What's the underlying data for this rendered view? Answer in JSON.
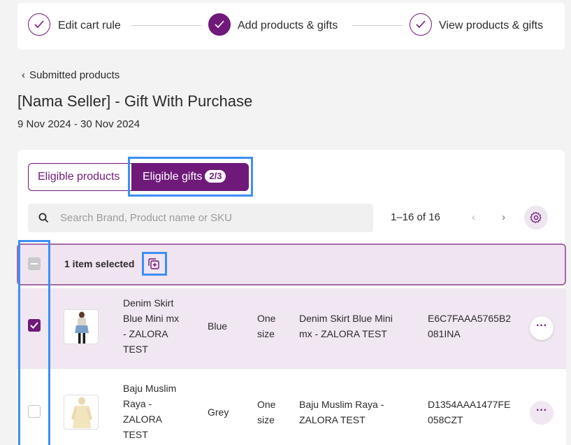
{
  "stepper": {
    "steps": [
      {
        "label": "Edit cart rule",
        "state": "done"
      },
      {
        "label": "Add products & gifts",
        "state": "active"
      },
      {
        "label": "View products & gifts",
        "state": "done"
      }
    ]
  },
  "header": {
    "back_label": "Submitted products",
    "title": "[Nama Seller] - Gift With Purchase",
    "date_range": "9 Nov 2024 - 30 Nov 2024"
  },
  "tabs": {
    "eligible_products": "Eligible products",
    "eligible_gifts": "Eligible gifts",
    "gifts_badge": "2/3"
  },
  "search": {
    "placeholder": "Search Brand, Product name or SKU",
    "value": ""
  },
  "pagination": {
    "label": "1–16 of 16"
  },
  "bulk": {
    "selected_text": "1 item selected"
  },
  "rows": [
    {
      "selected": true,
      "name_lines": [
        "Denim Skirt",
        "Blue Mini mx",
        "- ZALORA",
        "TEST"
      ],
      "color": "Blue",
      "size_lines": [
        "One",
        "size"
      ],
      "simple_name_lines": [
        "Denim Skirt Blue Mini",
        "mx - ZALORA TEST"
      ],
      "sku_lines": [
        "E6C7FAAA5765B2",
        "081INA"
      ]
    },
    {
      "selected": false,
      "name_lines": [
        "Baju Muslim",
        "Raya -",
        "ZALORA",
        "TEST"
      ],
      "color": "Grey",
      "size_lines": [
        "One",
        "size"
      ],
      "simple_name_lines": [
        "Baju Muslim Raya -",
        "ZALORA TEST"
      ],
      "sku_lines": [
        "D1354AAA1477FE",
        "058CZT"
      ]
    }
  ],
  "colors": {
    "brand": "#6f1a7a",
    "highlight": "#3d8ff5"
  }
}
